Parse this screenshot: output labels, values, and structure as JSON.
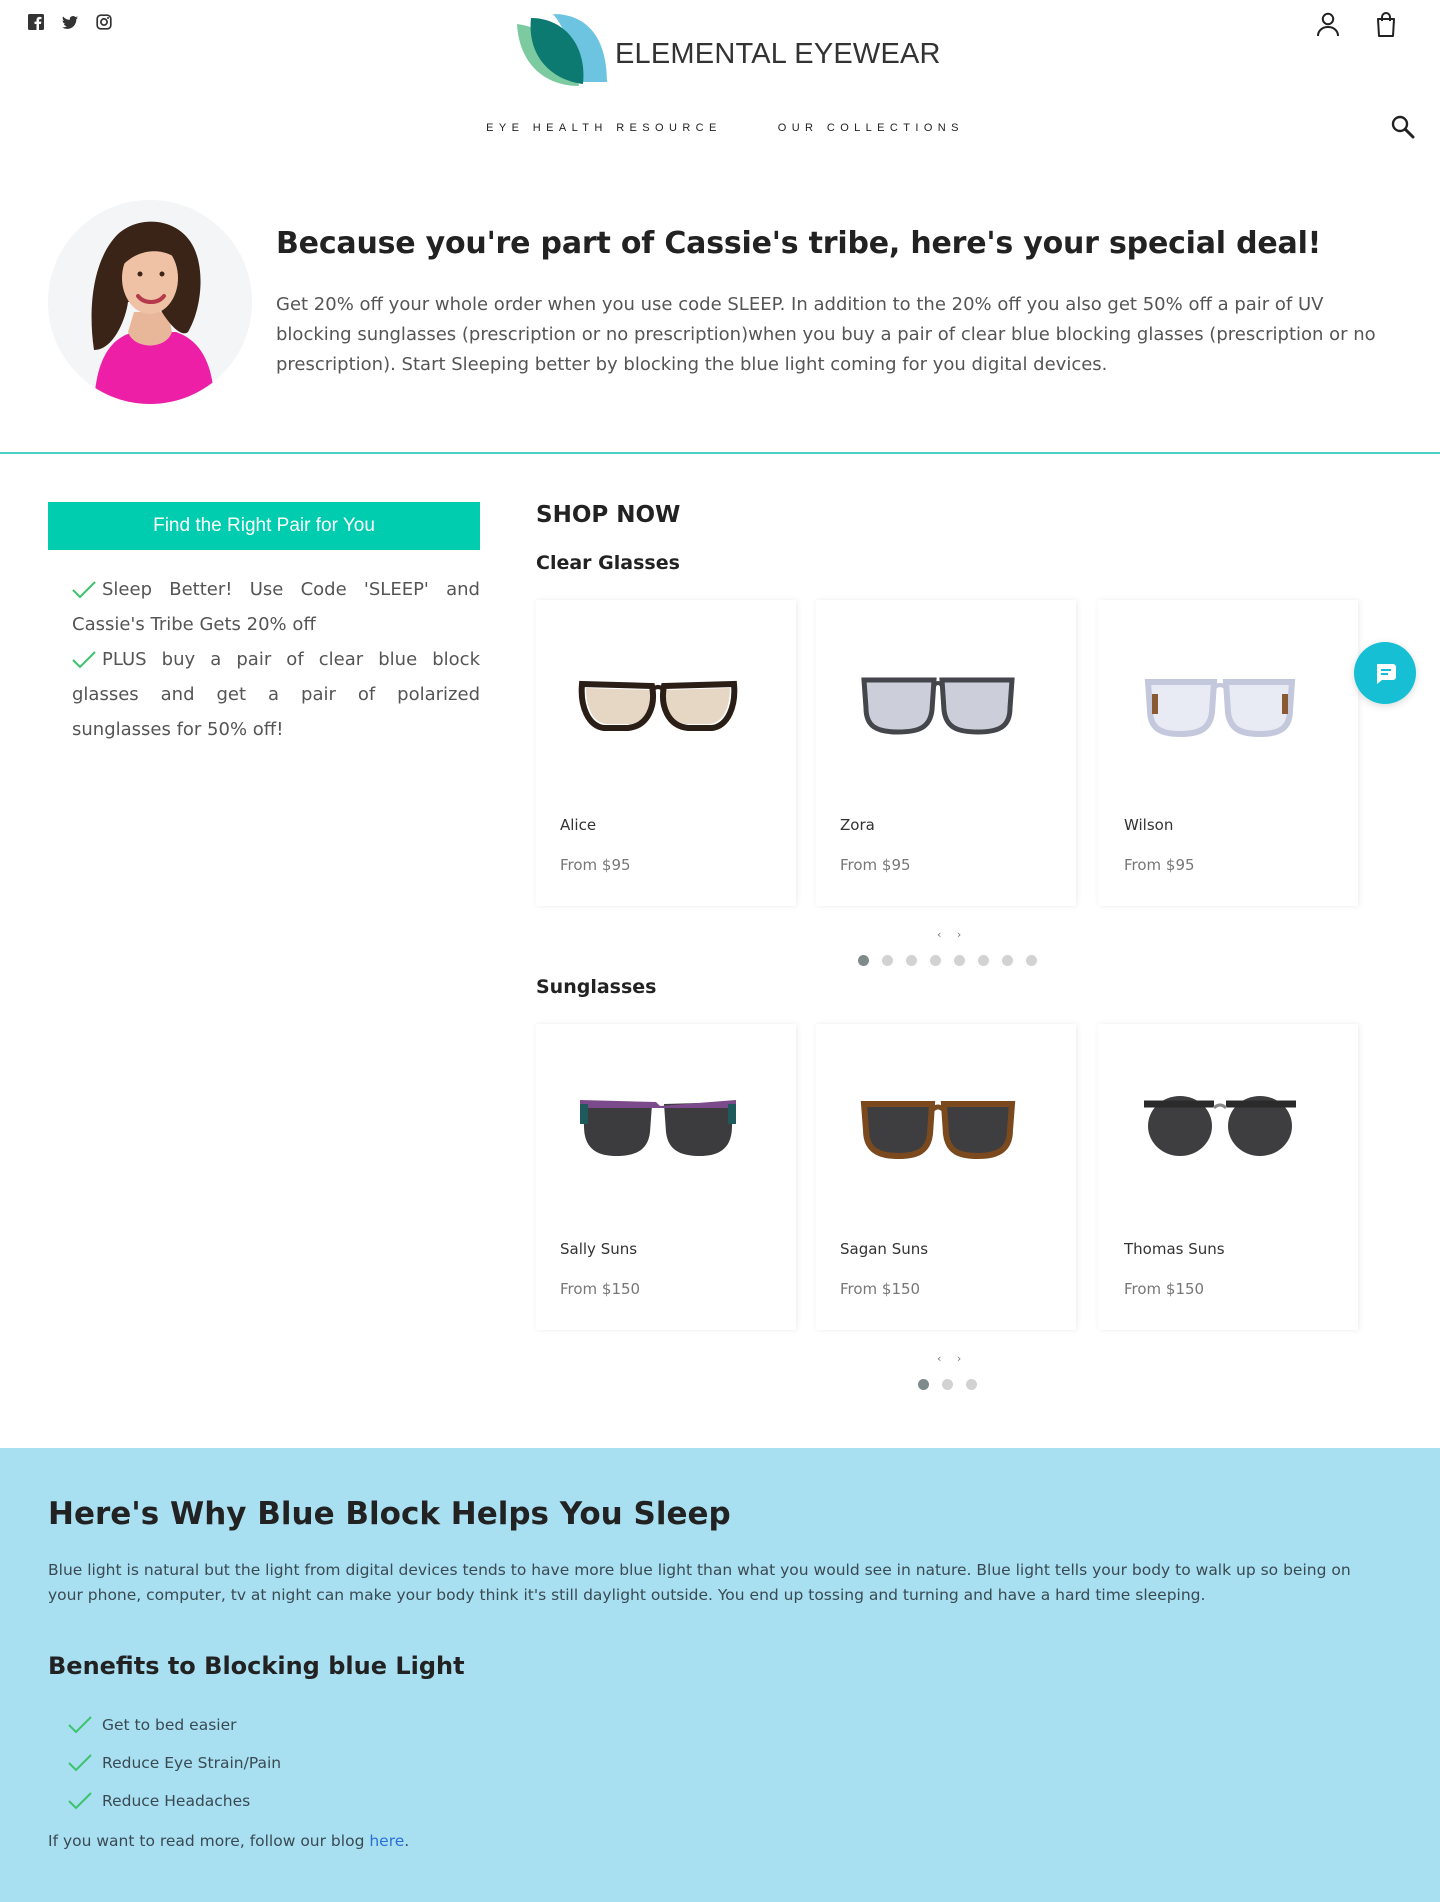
{
  "header": {
    "brand": "ELEMENTAL EYEWEAR",
    "social_icons": [
      "facebook-icon",
      "twitter-icon",
      "instagram-icon"
    ],
    "nav": [
      "EYE HEALTH RESOURCE",
      "OUR COLLECTIONS"
    ]
  },
  "hero": {
    "title": "Because you're part of Cassie's tribe, here's your special deal!",
    "body": "Get 20% off your whole order when you use code SLEEP. In addition to the 20% off you also get 50% off a pair of UV blocking sunglasses (prescription or no prescription)when you buy a pair of clear blue blocking glasses (prescription or no prescription). Start Sleeping better by blocking the blue light coming for you digital devices."
  },
  "sidebar": {
    "cta_label": "Find the Right Pair for You",
    "promos": [
      "Sleep Better! Use Code 'SLEEP' and Cassie's Tribe Gets 20% off",
      "PLUS buy a pair of clear blue block glasses and get a pair of polarized sunglasses for 50% off!"
    ]
  },
  "shop": {
    "title": "SHOP NOW",
    "clear": {
      "title": "Clear Glasses",
      "products": [
        {
          "name": "Alice",
          "price": "From $95"
        },
        {
          "name": "Zora",
          "price": "From $95"
        },
        {
          "name": "Wilson",
          "price": "From $95"
        }
      ],
      "arrows": "‹ ›",
      "page_count": 8,
      "current_page": 1
    },
    "sun": {
      "title": "Sunglasses",
      "products": [
        {
          "name": "Sally Suns",
          "price": "From $150"
        },
        {
          "name": "Sagan Suns",
          "price": "From $150"
        },
        {
          "name": "Thomas Suns",
          "price": "From $150"
        }
      ],
      "arrows": "‹ ›",
      "page_count": 3,
      "current_page": 1
    }
  },
  "info": {
    "title": "Here's Why Blue Block Helps You Sleep",
    "body": "Blue light is natural but the light from digital devices tends to have more blue light than what you would see in nature. Blue light tells your body to walk up so being on your phone, computer, tv at night can make your body think it's still daylight outside. You end up tossing and turning and have a hard time sleeping.",
    "benefits_title": "Benefits to Blocking blue Light",
    "benefits": [
      "Get to bed easier",
      "Reduce Eye Strain/Pain",
      "Reduce Headaches"
    ],
    "blog_prefix": "If you want to read more, follow our blog ",
    "blog_link": "here",
    "blog_suffix": "."
  },
  "colors": {
    "accent": "#00cdb0",
    "divider": "#4ccfc4",
    "info_bg": "#a8dff1",
    "chat": "#16bfd3",
    "check": "#3cc46c",
    "link": "#2b6fd6"
  }
}
